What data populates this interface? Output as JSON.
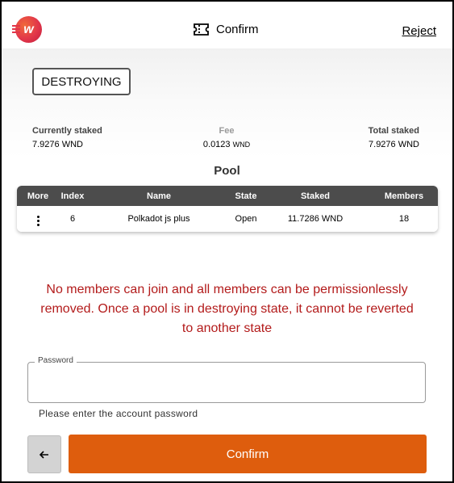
{
  "header": {
    "logo_letter": "w",
    "title": "Confirm",
    "reject_label": "Reject",
    "title_icon": "ticket-icon"
  },
  "summary": {
    "state": "DESTROYING",
    "currently_staked_label": "Currently staked",
    "currently_staked_value": "7.9276 WND",
    "fee_label": "Fee",
    "fee_value_main": "0.0123",
    "fee_value_unit": "WND",
    "total_staked_label": "Total staked",
    "total_staked_value": "7.9276 WND"
  },
  "pool": {
    "title": "Pool",
    "columns": [
      "More",
      "Index",
      "Name",
      "State",
      "Staked",
      "Members"
    ],
    "rows": [
      {
        "more_icon": "more-vertical-icon",
        "index": "6",
        "name": "Polkadot js plus",
        "state": "Open",
        "staked": "11.7286 WND",
        "members": "18"
      }
    ]
  },
  "warning": "No members can join and all members can be permissionlessly removed. Once a pool is in destroying state, it cannot be reverted to another state",
  "password": {
    "label": "Password",
    "value": "",
    "helper": "Please enter the account password"
  },
  "actions": {
    "back_icon": "arrow-left-icon",
    "confirm_label": "Confirm"
  },
  "colors": {
    "accent": "#de5d0d",
    "warning_text": "#b31b1b",
    "table_header": "#4c4c4c"
  }
}
